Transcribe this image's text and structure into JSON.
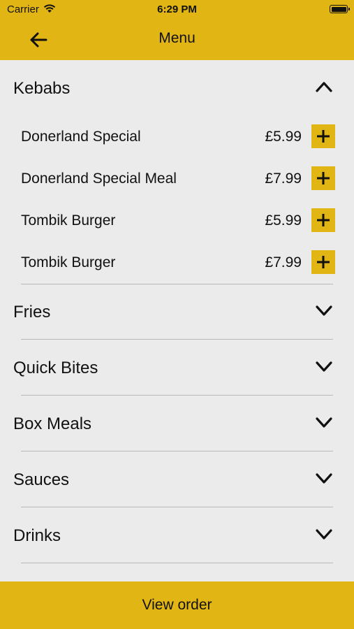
{
  "status": {
    "carrier": "Carrier",
    "time": "6:29 PM"
  },
  "nav": {
    "title": "Menu",
    "back_icon": "arrow-left-icon"
  },
  "colors": {
    "accent": "#e1b514",
    "background": "#ebebeb",
    "separator": "#b8b8b8"
  },
  "sections": [
    {
      "label": "Kebabs",
      "expanded": true,
      "items": [
        {
          "name": "Donerland Special",
          "price": "£5.99"
        },
        {
          "name": "Donerland Special Meal",
          "price": "£7.99"
        },
        {
          "name": "Tombik Burger",
          "price": "£5.99"
        },
        {
          "name": "Tombik Burger",
          "price": "£7.99"
        }
      ]
    },
    {
      "label": "Fries",
      "expanded": false
    },
    {
      "label": "Quick Bites",
      "expanded": false
    },
    {
      "label": "Box Meals",
      "expanded": false
    },
    {
      "label": "Sauces",
      "expanded": false
    },
    {
      "label": "Drinks",
      "expanded": false
    }
  ],
  "footer": {
    "view_order_label": "View order"
  }
}
